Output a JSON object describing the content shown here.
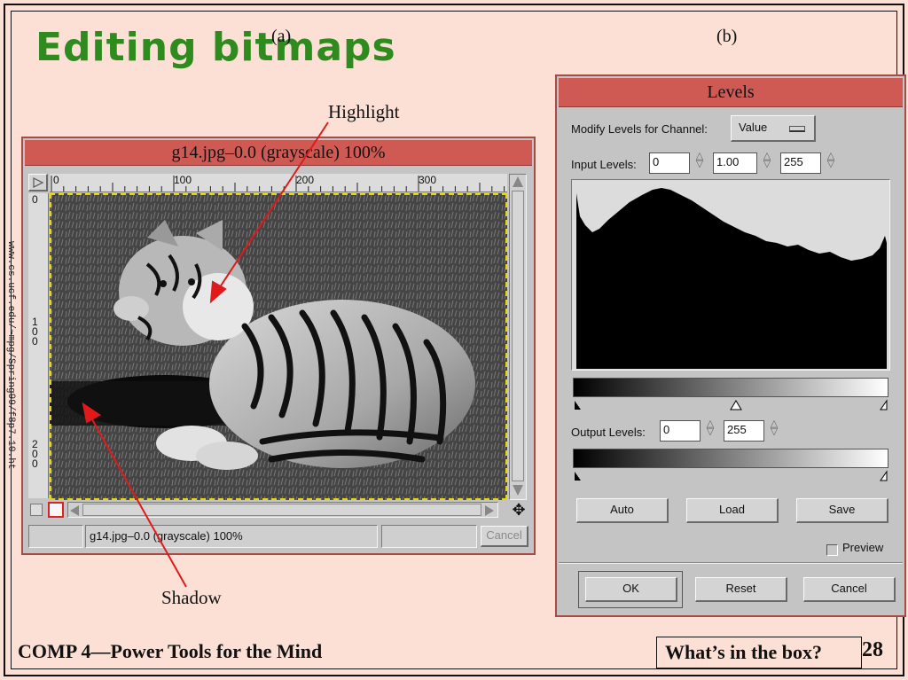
{
  "slide": {
    "title": "Editing bitmaps",
    "label_a": "(a)",
    "label_b": "(b)",
    "annotation_highlight": "Highlight",
    "annotation_shadow": "Shadow",
    "footer_left": "COMP 4—Power Tools for the Mind",
    "footer_right": "What’s in the box?",
    "page_number": "28",
    "side_text": "www.cs.ucf.edu/~mpg/Spring99/f8p7.10.html"
  },
  "colors": {
    "slide_background": "#fde0d5",
    "title_green": "#2e8b1e",
    "titlebar_red": "#cf5a53",
    "arrow_red": "#e01a1a"
  },
  "image_window": {
    "title": "g14.jpg–0.0 (grayscale) 100%",
    "ruler_h_labels": [
      "0",
      "100",
      "200",
      "300"
    ],
    "ruler_v_labels": [
      "0",
      "100",
      "200"
    ],
    "status_text": "g14.jpg–0.0 (grayscale) 100%",
    "cancel_label": "Cancel"
  },
  "levels_dialog": {
    "title": "Levels",
    "channel_label": "Modify Levels for Channel:",
    "channel_value": "Value",
    "input_levels_label": "Input Levels:",
    "input_low": "0",
    "input_gamma": "1.00",
    "input_high": "255",
    "output_levels_label": "Output Levels:",
    "output_low": "0",
    "output_high": "255",
    "auto_label": "Auto",
    "load_label": "Load",
    "save_label": "Save",
    "preview_label": "Preview",
    "preview_checked": false,
    "ok_label": "OK",
    "reset_label": "Reset",
    "cancel_label": "Cancel"
  }
}
